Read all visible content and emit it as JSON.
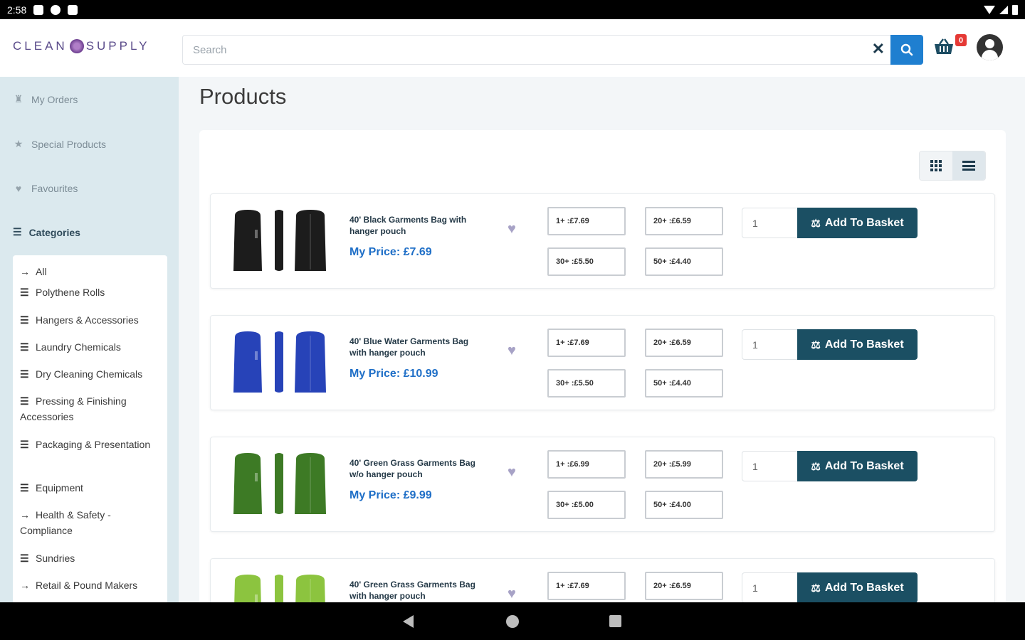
{
  "status_bar": {
    "time": "2:58"
  },
  "header": {
    "logo_text_left": "CLEAN",
    "logo_text_right": "SUPPLY",
    "search_placeholder": "Search",
    "clear_glyph": "✕",
    "basket_count": "0"
  },
  "sidebar": {
    "links": [
      {
        "label": "My Orders",
        "icon": "basket-icon"
      },
      {
        "label": "Special Products",
        "icon": "star-icon"
      },
      {
        "label": "Favourites",
        "icon": "heart-icon"
      }
    ],
    "categories_label": "Categories",
    "categories": [
      {
        "label": "All",
        "icon": "arrow-right-icon"
      },
      {
        "label": "Polythene Rolls",
        "icon": "list-icon"
      },
      {
        "label": "Hangers & Accessories",
        "icon": "list-icon"
      },
      {
        "label": "Laundry Chemicals",
        "icon": "list-icon"
      },
      {
        "label": "Dry Cleaning Chemicals",
        "icon": "list-icon"
      },
      {
        "label": "Pressing & Finishing Accessories",
        "icon": "list-icon"
      },
      {
        "label": "Packaging & Presentation",
        "icon": "list-icon"
      },
      {
        "label": "Equipment",
        "icon": "list-icon"
      },
      {
        "label": "Health & Safety - Compliance",
        "icon": "arrow-right-icon"
      },
      {
        "label": "Sundries",
        "icon": "list-icon"
      },
      {
        "label": "Retail & Pound Makers",
        "icon": "arrow-right-icon"
      }
    ]
  },
  "main": {
    "title": "Products",
    "add_label": "Add To Basket",
    "products": [
      {
        "name": "40' Black Garments Bag with hanger pouch",
        "price": "My Price: £7.69",
        "color": "#1c1c1c",
        "tiers": [
          "1+ :£7.69",
          "20+ :£6.59",
          "30+ :£5.50",
          "50+ :£4.40"
        ],
        "qty": "1"
      },
      {
        "name": "40' Blue Water Garments Bag with hanger pouch",
        "price": "My Price: £10.99",
        "color": "#2743b8",
        "tiers": [
          "1+ :£7.69",
          "20+ :£6.59",
          "30+ :£5.50",
          "50+ :£4.40"
        ],
        "qty": "1"
      },
      {
        "name": "40' Green Grass Garments Bag w/o hanger pouch",
        "price": "My Price: £9.99",
        "color": "#3d7a25",
        "tiers": [
          "1+ :£6.99",
          "20+ :£5.99",
          "30+ :£5.00",
          "50+ :£4.00"
        ],
        "qty": "1"
      },
      {
        "name": "40' Green Grass Garments Bag with hanger pouch",
        "price": "",
        "color": "#8cc43f",
        "tiers": [
          "1+ :£7.69",
          "20+ :£6.59",
          "",
          ""
        ],
        "qty": "1"
      }
    ]
  },
  "colors": {
    "accent_blue": "#1f7fd0",
    "add_button": "#1b4f63",
    "sidebar_bg": "#dbe9ee",
    "price_text": "#1f6fc7",
    "badge_red": "#e53935"
  }
}
